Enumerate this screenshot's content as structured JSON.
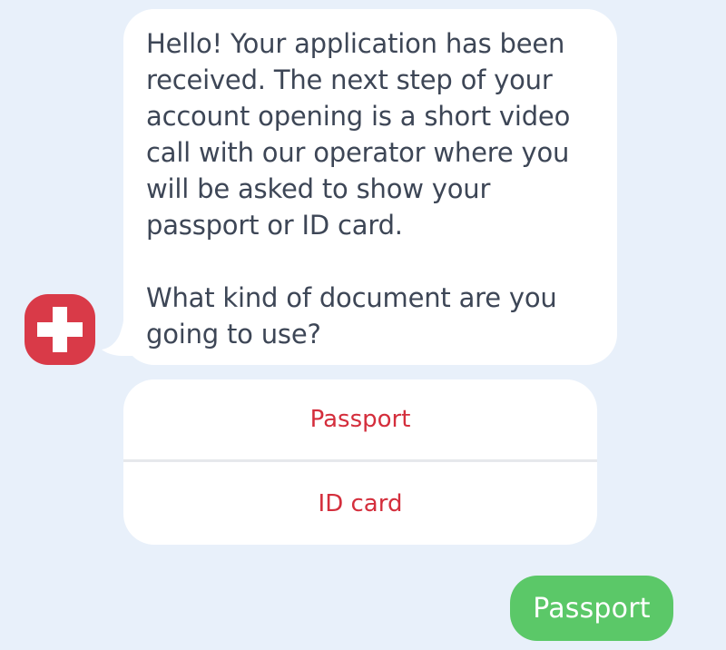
{
  "bot": {
    "avatar_icon": "swiss-cross-icon",
    "avatar_color": "#d93a48",
    "message": {
      "paragraph_1": "Hello! Your application has been\nreceived. The next step of your\naccount opening is a short video\ncall with our operator where you\nwill be asked to show your\npassport or ID card.",
      "paragraph_2": "What kind of document are you\ngoing to use?"
    }
  },
  "quick_replies": [
    {
      "label": "Passport"
    },
    {
      "label": "ID card"
    }
  ],
  "user": {
    "reply": "Passport",
    "bubble_color": "#5bc868"
  },
  "colors": {
    "background": "#e8f0fa",
    "option_text": "#d42e3c",
    "message_text": "#3d4656"
  }
}
